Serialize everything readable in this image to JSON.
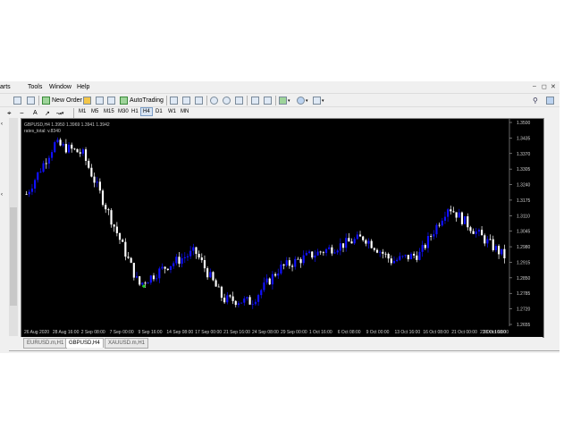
{
  "menu": [
    "arts",
    "Tools",
    "Window",
    "Help"
  ],
  "toolbar": {
    "new_order": "New Order",
    "autotrading": "AutoTrading"
  },
  "tool_letter": "A",
  "timeframes": [
    "M1",
    "M5",
    "M15",
    "M30",
    "H1",
    "H4",
    "D1",
    "W1",
    "MN"
  ],
  "active_timeframe": "H4",
  "chart": {
    "header": "GBPUSD,H4  1.3950 1.3969 1.3941 1.3942",
    "indicator": "rates_total: v.8340",
    "y_ticks": [
      "1.3500",
      "1.3435",
      "1.3370",
      "1.3305",
      "1.3240",
      "1.3175",
      "1.3110",
      "1.3045",
      "1.2980",
      "1.2915",
      "1.2850",
      "1.2785",
      "1.2720",
      "1.2655"
    ],
    "x_ticks": [
      "26 Aug 2020",
      "28 Aug 16:00",
      "2 Sep 08:00",
      "7 Sep 00:00",
      "9 Sep 16:00",
      "14 Sep 08:00",
      "17 Sep 00:00",
      "21 Sep 16:00",
      "24 Sep 08:00",
      "29 Sep 00:00",
      "1 Oct 16:00",
      "6 Oct 08:00",
      "9 Oct 00:00",
      "13 Oct 16:00",
      "16 Oct 08:00",
      "21 Oct 00:00",
      "23 Oct 16:00",
      "28 Oct 08:00"
    ],
    "bull_color": "#1010ff",
    "bear_color": "#ffffff",
    "signal_color": "#22cc22"
  },
  "chart_data": {
    "type": "line",
    "title": "GBPUSD,H4",
    "ylim": [
      1.2655,
      1.35
    ],
    "x": [
      "26 Aug 2020",
      "28 Aug 16:00",
      "2 Sep 08:00",
      "7 Sep 00:00",
      "9 Sep 16:00",
      "14 Sep 08:00",
      "17 Sep 00:00",
      "21 Sep 16:00",
      "24 Sep 08:00",
      "29 Sep 00:00",
      "1 Oct 16:00",
      "6 Oct 08:00",
      "9 Oct 00:00",
      "13 Oct 16:00",
      "16 Oct 08:00",
      "21 Oct 00:00",
      "23 Oct 16:00",
      "28 Oct 08:00"
    ],
    "series": [
      {
        "name": "GBPUSD,H4",
        "values": [
          1.32,
          1.341,
          1.337,
          1.31,
          1.282,
          1.29,
          1.296,
          1.276,
          1.275,
          1.289,
          1.294,
          1.298,
          1.302,
          1.292,
          1.295,
          1.315,
          1.304,
          1.294
        ]
      }
    ]
  },
  "tabs": [
    "EURUSD.m,H1",
    "GBPUSD,H4",
    "XAUUSD.m,H1"
  ],
  "active_tab": "GBPUSD,H4"
}
